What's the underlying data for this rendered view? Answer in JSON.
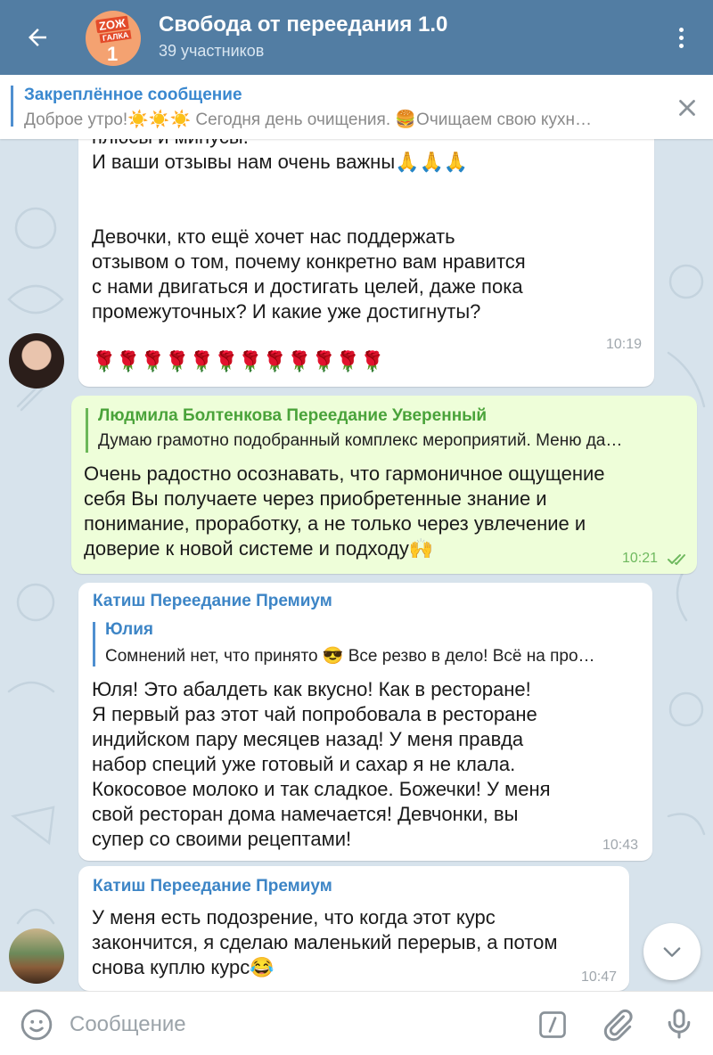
{
  "header": {
    "title": "Свобода от переедания 1.0",
    "subtitle": "39 участников",
    "avatar_text_1": "ZOЖ",
    "avatar_text_2": "ГАЛКА",
    "avatar_text_3": "1"
  },
  "pinned": {
    "title": "Закреплённое сообщение",
    "text": "Доброе утро!☀️☀️☀️   Сегодня день очищения.  🍔Очищаем свою кухн…"
  },
  "messages": [
    {
      "type": "in",
      "text": "плюсы и минусы.\nИ ваши отзывы нам очень важны🙏🙏🙏\n\n\nДевочки, кто ещё хочет нас поддержать\nотзывом о том, почему конкретно вам нравится\nс нами двигаться и достигать целей, даже пока\nпромежуточных? И какие уже достигнуты?\n\n🌹🌹🌹🌹🌹🌹🌹🌹🌹🌹🌹🌹",
      "time": "10:19"
    },
    {
      "type": "out",
      "quote_name": "Людмила Болтенкова Переедание Уверенный",
      "quote_text": "Думаю грамотно подобранный комплекс мероприятий. Меню да…",
      "text": "Очень радостно осознавать, что гармоничное ощущение\nсебя Вы получаете через приобретенные знание и\nпонимание, проработку, а не только через увлечение и\nдоверие к новой системе и подходу🙌",
      "time": "10:21"
    },
    {
      "type": "in",
      "sender": "Катиш Переедание Премиум",
      "quote_name": "Юлия",
      "quote_text": "Сомнений нет, что принято 😎 Все резво в дело! Всё на про…",
      "text": "Юля! Это абалдеть как вкусно! Как в ресторане!\nЯ первый раз этот чай попробовала в ресторане\nиндийском пару месяцев назад! У меня правда\nнабор специй уже готовый и сахар я не клала.\nКокосовое молоко и так сладкое. Божечки! У меня\nсвой ресторан дома намечается! Девчонки, вы\nсупер со своими рецептами!",
      "time": "10:43"
    },
    {
      "type": "in",
      "sender": "Катиш Переедание Премиум",
      "text": "У меня есть подозрение, что когда этот курс\nзакончится, я сделаю маленький перерыв, а потом\nснова куплю курс😂",
      "time": "10:47"
    }
  ],
  "input": {
    "placeholder": "Сообщение"
  },
  "colors": {
    "header": "#527da3",
    "accent": "#3d85c6",
    "outgoing_bubble": "#eefed9",
    "chat_bg": "#d7e3ec"
  },
  "icons": [
    "back-arrow-icon",
    "more-vert-icon",
    "close-icon",
    "emoji-icon",
    "bot-command-icon",
    "attach-icon",
    "mic-icon",
    "chevron-down-icon",
    "read-checks-icon"
  ]
}
